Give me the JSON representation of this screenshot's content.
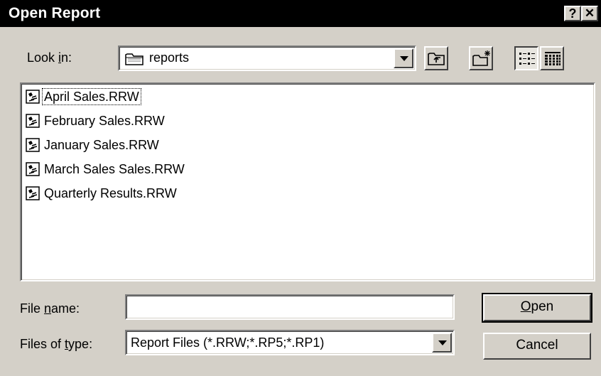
{
  "window": {
    "title": "Open Report",
    "help_button": "?",
    "close_button": "✕"
  },
  "look_in": {
    "label_pre": "Look ",
    "label_mnemonic": "i",
    "label_post": "n:",
    "value": "reports"
  },
  "toolbar": {
    "up_one_level": "up-folder-icon",
    "create_new_folder": "new-folder-icon",
    "list_view": "list-view-icon",
    "details_view": "details-view-icon"
  },
  "files": [
    {
      "name": "April Sales.RRW",
      "focused": true
    },
    {
      "name": "February Sales.RRW",
      "focused": false
    },
    {
      "name": "January Sales.RRW",
      "focused": false
    },
    {
      "name": "March Sales Sales.RRW",
      "focused": false
    },
    {
      "name": "Quarterly Results.RRW",
      "focused": false
    }
  ],
  "file_name": {
    "label_pre": "File ",
    "label_mnemonic": "n",
    "label_post": "ame:",
    "value": ""
  },
  "file_type": {
    "label_pre": "Files of ",
    "label_mnemonic": "t",
    "label_post": "ype:",
    "value": "Report Files (*.RRW;*.RP5;*.RP1)"
  },
  "buttons": {
    "open_mnemonic": "O",
    "open_rest": "pen",
    "cancel": "Cancel"
  },
  "colors": {
    "face": "#d4d0c8",
    "titlebar": "#000000",
    "list_background": "#ffffff"
  }
}
